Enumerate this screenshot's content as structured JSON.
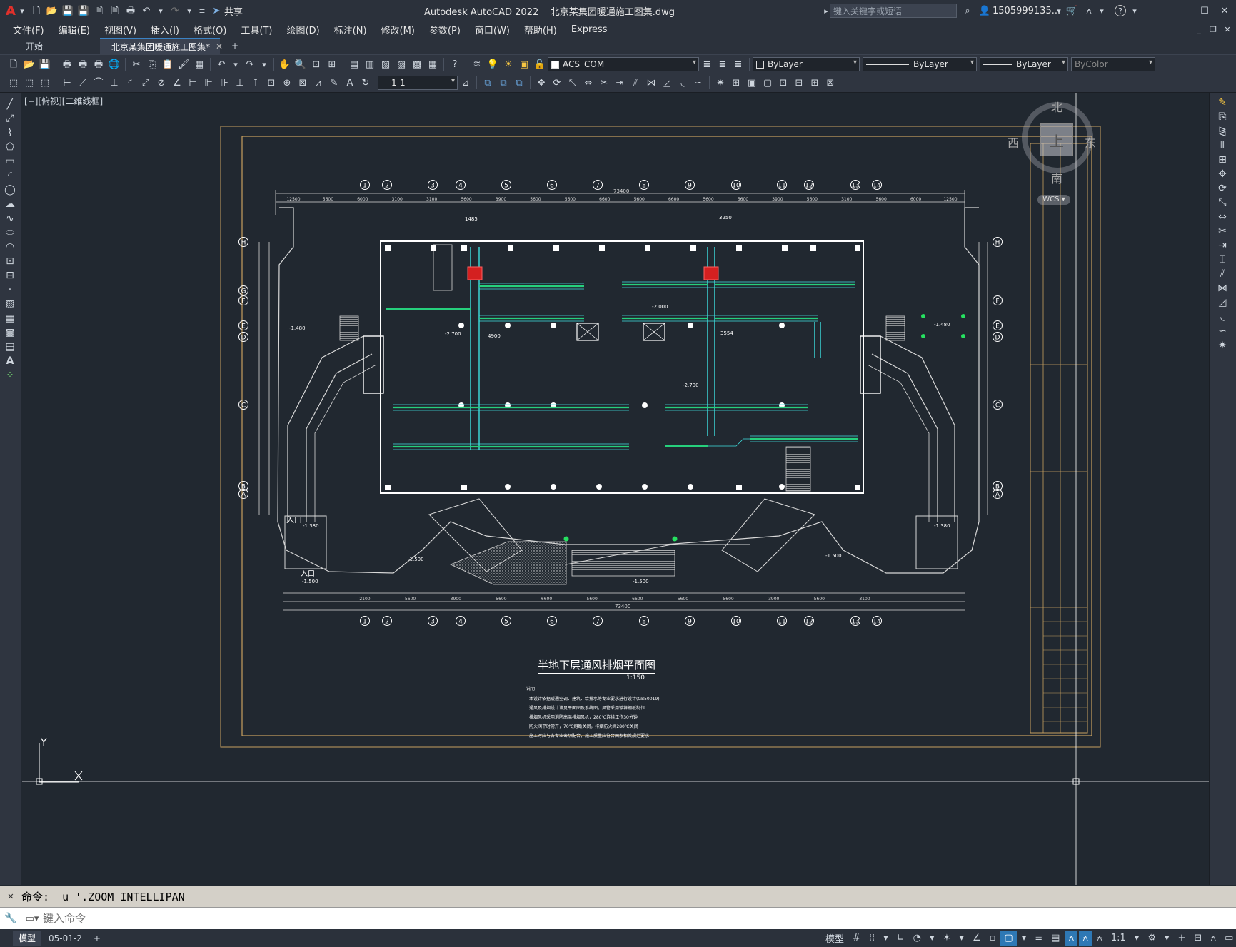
{
  "titlebar": {
    "app_logo": "A",
    "share_label": "共享",
    "title": "Autodesk AutoCAD 2022    北京某集团暖通施工图集.dwg",
    "search_placeholder": "键入关键字或短语",
    "user": "1505999135...",
    "help": "?"
  },
  "menus": [
    "文件(F)",
    "编辑(E)",
    "视图(V)",
    "插入(I)",
    "格式(O)",
    "工具(T)",
    "绘图(D)",
    "标注(N)",
    "修改(M)",
    "参数(P)",
    "窗口(W)",
    "帮助(H)",
    "Express"
  ],
  "tabs": {
    "start": "开始",
    "doc": "北京某集团暖通施工图集*",
    "add": "+"
  },
  "toolbar1": {
    "layer": "ACS_COM",
    "color": "ByLayer",
    "linetype": "ByLayer",
    "lineweight": "ByLayer",
    "plotstyle": "ByColor"
  },
  "toolbar2": {
    "dimstyle": "1-1"
  },
  "viewport_label": "[−][俯视][二维线框]",
  "viewcube": {
    "north": "北",
    "south": "南",
    "east": "东",
    "west": "西",
    "top": "上",
    "wcs": "WCS"
  },
  "drawing": {
    "title": "半地下层通风排烟平面图",
    "scale": "1:150",
    "notes_header": "说明",
    "notes": [
      "本设计依据暖通空调、建筑、给排水等专业要求进行设计(GB50019)",
      "通风及排烟设计详见平面图及系统图，风管采用镀锌钢板制作",
      "排烟风机采用消防高温排烟风机，280℃连续工作30分钟",
      "防火阀平时常开，70℃熔断关闭，排烟防火阀280℃关闭",
      "施工时应与各专业密切配合，施工质量应符合国家相关规范要求"
    ],
    "grid_top": [
      "1",
      "2",
      "3",
      "4",
      "5",
      "6",
      "7",
      "8",
      "9",
      "10",
      "11",
      "12",
      "13",
      "14"
    ],
    "grid_side_left": [
      "H",
      "G",
      "F",
      "E",
      "D",
      "C",
      "B",
      "A"
    ],
    "grid_side_right": [
      "H",
      "F",
      "E",
      "D",
      "C",
      "B",
      "A"
    ],
    "total_dim": "73400",
    "dims_top": [
      "12500",
      "5600",
      "6000",
      "3100",
      "3100",
      "5600",
      "3900",
      "5600",
      "5600",
      "6600",
      "5600",
      "6600",
      "5600",
      "5600",
      "3900",
      "5600",
      "3100",
      "5600",
      "6000",
      "12500"
    ],
    "dims_bottom": [
      "2100",
      "5600",
      "3900",
      "5600",
      "6600",
      "5600",
      "6600",
      "5600",
      "5600",
      "3900",
      "5600",
      "3100"
    ],
    "labels": {
      "entrance": "入口",
      "level_a": "-1.380",
      "level_b": "-1.500",
      "level_c": "-1.480",
      "level_d": "-2.000",
      "level_e": "-2.700",
      "dim_a": "4900",
      "dim_b": "3554",
      "dim_c": "1485",
      "dim_d": "3250"
    }
  },
  "command": {
    "history": "命令: _u '.ZOOM INTELLIPAN",
    "placeholder": "键入命令"
  },
  "status": {
    "model_tab": "模型",
    "layout_tab": "05-01-2",
    "add": "+",
    "model_btn": "模型",
    "scale": "1:1"
  }
}
